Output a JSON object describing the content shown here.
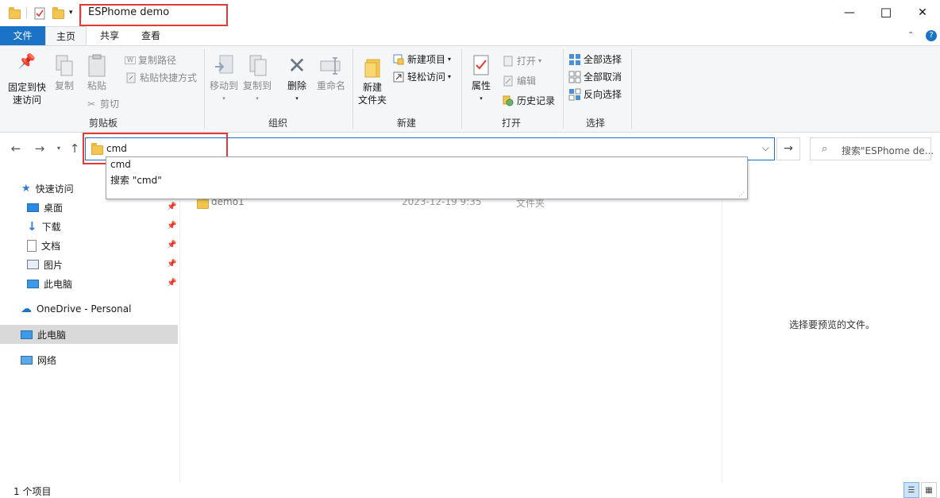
{
  "window": {
    "title": "ESPhome demo",
    "minimize_glyph": "—",
    "maximize_glyph": "☐",
    "close_glyph": "✕"
  },
  "ribbon_tabs": {
    "file": "文件",
    "home": "主页",
    "share": "共享",
    "view": "查看"
  },
  "ribbon": {
    "clipboard": {
      "pin_quick_access": [
        "固定到快",
        "速访问"
      ],
      "copy": "复制",
      "paste": "粘贴",
      "copy_path": "复制路径",
      "paste_shortcut": "粘贴快捷方式",
      "cut": "剪切",
      "group_label": "剪贴板"
    },
    "organize": {
      "move_to": "移动到",
      "copy_to": "复制到",
      "delete": "删除",
      "rename": "重命名",
      "group_label": "组织"
    },
    "new": {
      "new_folder": [
        "新建",
        "文件夹"
      ],
      "new_item": "新建项目",
      "easy_access": "轻松访问",
      "group_label": "新建"
    },
    "open": {
      "properties": "属性",
      "open": "打开",
      "edit": "编辑",
      "history": "历史记录",
      "group_label": "打开"
    },
    "select": {
      "select_all": "全部选择",
      "select_none": "全部取消",
      "invert_selection": "反向选择",
      "group_label": "选择"
    }
  },
  "address": {
    "value": "cmd",
    "search_placeholder": "搜索\"ESPhome de..."
  },
  "autocomplete": {
    "items": [
      "cmd",
      "搜索 \"cmd\""
    ]
  },
  "navpane": {
    "quick_access": "快速访问",
    "desktop": "桌面",
    "downloads": "下载",
    "documents": "文档",
    "pictures": "图片",
    "this_pc_quick": "此电脑",
    "onedrive": "OneDrive - Personal",
    "this_pc": "此电脑",
    "network": "网络"
  },
  "files": [
    {
      "name": "demo1",
      "date": "2023-12-19 9:35",
      "type": "文件夹"
    }
  ],
  "preview": {
    "message": "选择要预览的文件。"
  },
  "status": {
    "item_count": "1 个项目"
  },
  "colors": {
    "accent": "#1a73c7",
    "highlight_box": "#e53935",
    "folder": "#f4c64f"
  }
}
